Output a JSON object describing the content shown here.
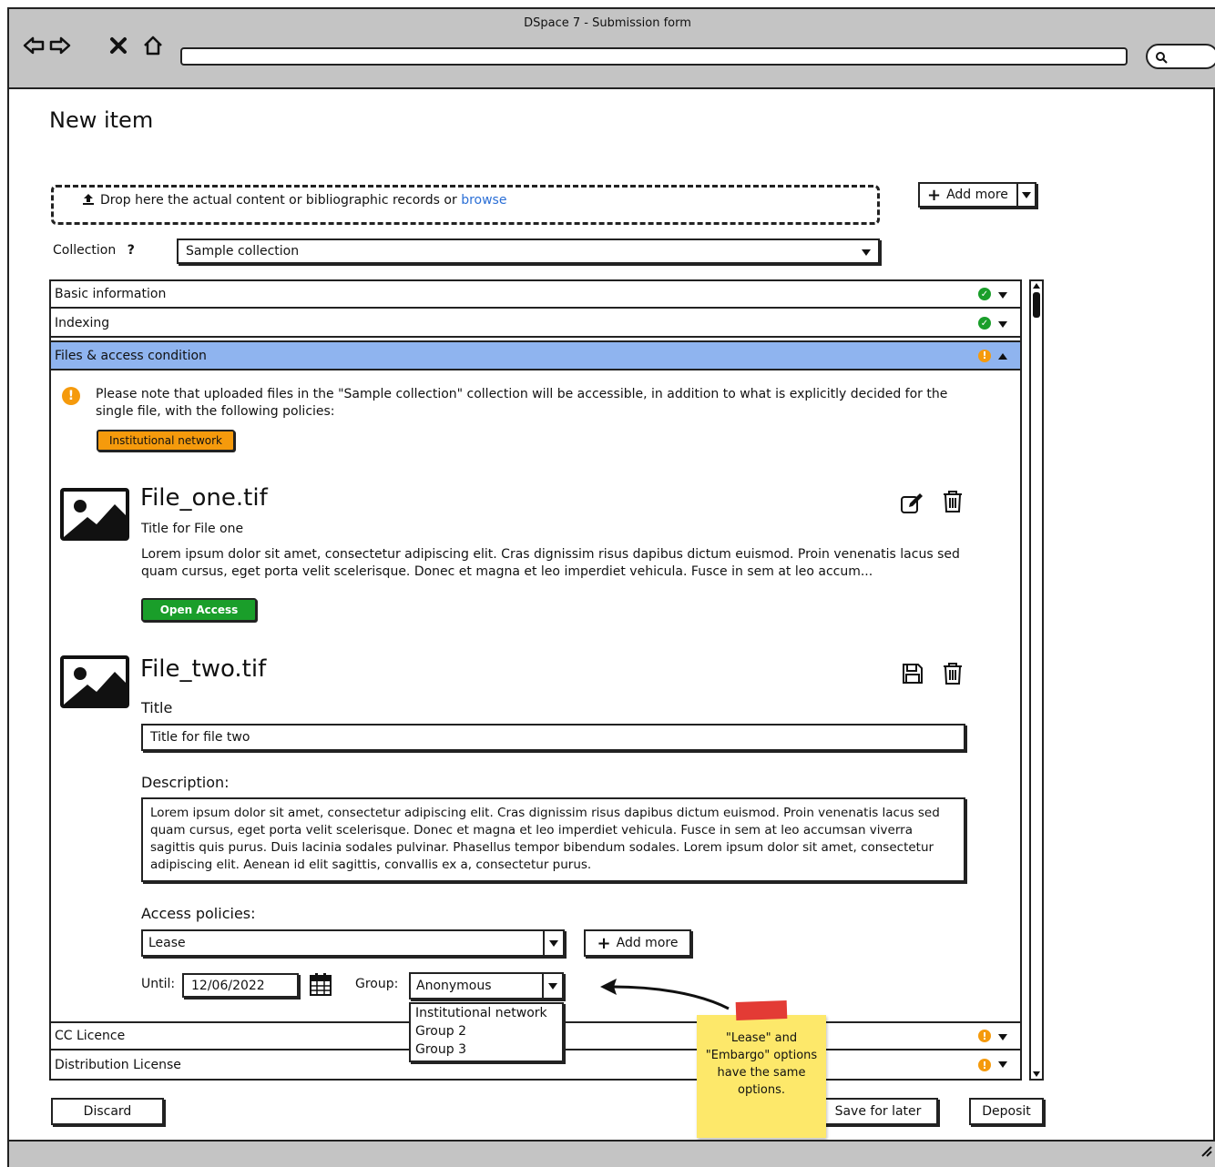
{
  "window": {
    "title": "DSpace 7 - Submission form"
  },
  "page": {
    "title": "New item"
  },
  "dropzone": {
    "text": "Drop here the actual content or bibliographic records or ",
    "link": "browse"
  },
  "add_more_top": {
    "label": "Add more"
  },
  "collection": {
    "label": "Collection",
    "help": "?",
    "value": "Sample collection"
  },
  "sections": [
    {
      "label": "Basic information",
      "status": "ok"
    },
    {
      "label": "Indexing",
      "status": "ok"
    },
    {
      "label": "Files & access condition",
      "status": "warning"
    },
    {
      "label": "CC Licence",
      "status": "warning"
    },
    {
      "label": "Distribution License",
      "status": "warning"
    }
  ],
  "notice": {
    "text": "Please note that uploaded files in the \"Sample collection\" collection will be accessible, in addition to what is explicitly decided for the single file, with the following policies:",
    "policy_badge": "Institutional network"
  },
  "file_one": {
    "name": "File_one.tif",
    "title": "Title for File one",
    "description": "Lorem ipsum dolor sit amet, consectetur adipiscing elit. Cras dignissim risus dapibus dictum euismod. Proin venenatis lacus sed quam cursus, eget porta velit scelerisque. Donec et magna et leo imperdiet vehicula. Fusce in sem at leo accum...",
    "access_badge": "Open Access"
  },
  "file_two": {
    "name": "File_two.tif",
    "title_label": "Title",
    "title_value": "Title for file two",
    "description_label": "Description:",
    "description_value": "Lorem ipsum dolor sit amet, consectetur adipiscing elit. Cras dignissim risus dapibus dictum euismod. Proin venenatis lacus sed quam cursus, eget porta velit scelerisque. Donec et magna et leo imperdiet vehicula. Fusce in sem at leo accumsan viverra sagittis quis purus. Duis lacinia sodales pulvinar. Phasellus tempor bibendum sodales. Lorem ipsum dolor sit amet, consectetur adipiscing elit. Aenean id elit sagittis, convallis ex a, consectetur purus.",
    "access_label": "Access policies:",
    "access_value": "Lease",
    "add_more_label": "Add more",
    "until_label": "Until:",
    "until_value": "12/06/2022",
    "group_label": "Group:",
    "group_value": "Anonymous",
    "group_options": [
      "Institutional network",
      "Group 2",
      "Group 3"
    ]
  },
  "sticky_note": {
    "text": "\"Lease\" and \"Embargo\" options have the same options."
  },
  "footer": {
    "discard": "Discard",
    "save_later": "Save for later",
    "deposit": "Deposit"
  },
  "colors": {
    "active_section": "#8fb4ef",
    "ok": "#1a9e2a",
    "warning": "#f59a0c",
    "open_access": "#1a9e2a",
    "policy_badge": "#f59a0c",
    "link": "#2b6fd6"
  }
}
